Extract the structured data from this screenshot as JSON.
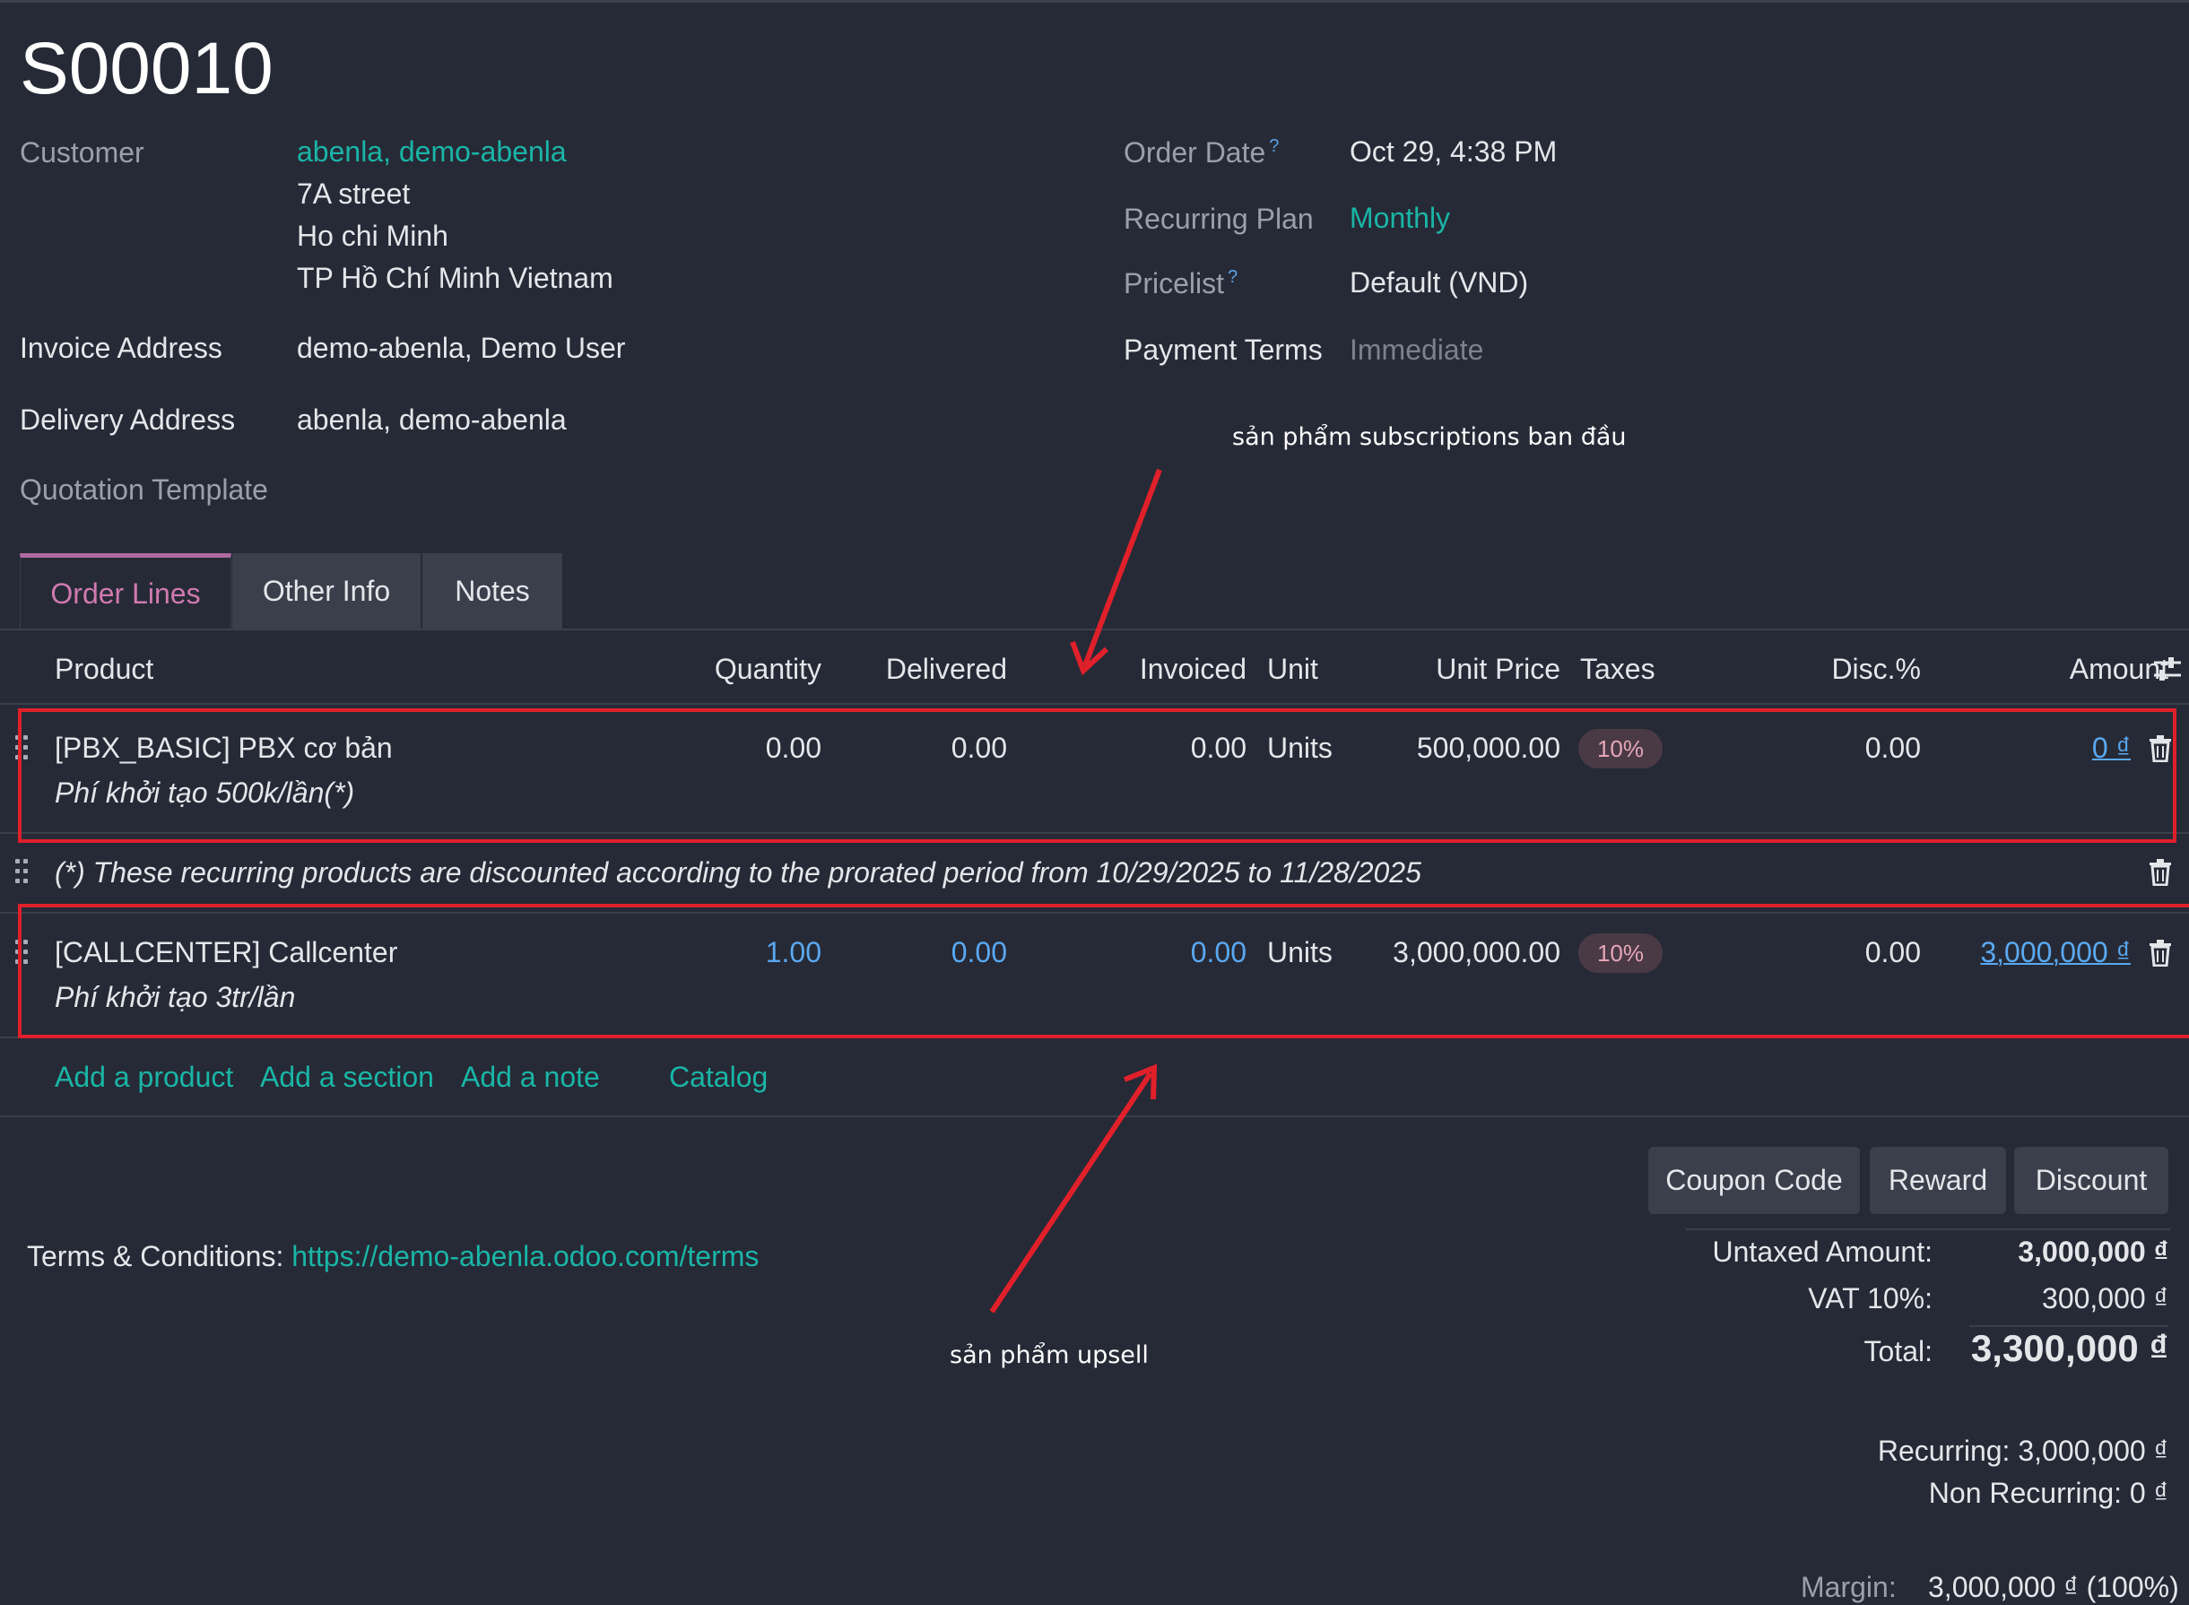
{
  "order": {
    "name": "S00010"
  },
  "left_fields": {
    "customer_label": "Customer",
    "customer_name": "abenla, demo-abenla",
    "customer_address": [
      "7A street",
      "Ho chi Minh",
      "TP Hồ Chí Minh Vietnam"
    ],
    "invoice_label": "Invoice Address",
    "invoice_value": "demo-abenla, Demo User",
    "delivery_label": "Delivery Address",
    "delivery_value": "abenla, demo-abenla",
    "template_label": "Quotation Template"
  },
  "right_fields": {
    "order_date_label": "Order Date",
    "order_date_value": "Oct 29, 4:38 PM",
    "recurring_plan_label": "Recurring Plan",
    "recurring_plan_value": "Monthly",
    "pricelist_label": "Pricelist",
    "pricelist_value": "Default (VND)",
    "payment_terms_label": "Payment Terms",
    "payment_terms_value": "Immediate",
    "help_mark": "?"
  },
  "tabs": [
    {
      "label": "Order Lines",
      "active": true
    },
    {
      "label": "Other Info",
      "active": false
    },
    {
      "label": "Notes",
      "active": false
    }
  ],
  "columns": {
    "product": "Product",
    "quantity": "Quantity",
    "delivered": "Delivered",
    "invoiced": "Invoiced",
    "unit": "Unit",
    "unit_price": "Unit Price",
    "taxes": "Taxes",
    "disc": "Disc.%",
    "amount": "Amount"
  },
  "lines": [
    {
      "product": "[PBX_BASIC] PBX cơ bản",
      "description": "Phí khởi tạo 500k/lần(*)",
      "quantity": "0.00",
      "delivered": "0.00",
      "invoiced": "0.00",
      "unit": "Units",
      "unit_price": "500,000.00",
      "tax": "10%",
      "disc": "0.00",
      "amount": "0 ₫"
    },
    {
      "note": "(*) These recurring products are discounted according to the prorated period from 10/29/2025 to 11/28/2025"
    },
    {
      "product": "[CALLCENTER] Callcenter",
      "description": "Phí khởi tạo 3tr/lần",
      "quantity": "1.00",
      "delivered": "0.00",
      "invoiced": "0.00",
      "unit": "Units",
      "unit_price": "3,000,000.00",
      "tax": "10%",
      "disc": "0.00",
      "amount": "3,000,000 ₫"
    }
  ],
  "actions": {
    "add_product": "Add a product",
    "add_section": "Add a section",
    "add_note": "Add a note",
    "catalog": "Catalog"
  },
  "buttons": {
    "coupon": "Coupon Code",
    "reward": "Reward",
    "discount": "Discount"
  },
  "terms": {
    "label": "Terms & Conditions:",
    "url": "https://demo-abenla.odoo.com/terms"
  },
  "totals": {
    "untaxed_label": "Untaxed Amount:",
    "untaxed_value": "3,000,000 ₫",
    "vat_label": "VAT 10%:",
    "vat_value": "300,000 ₫",
    "total_label": "Total:",
    "total_value": "3,300,000 ₫",
    "recurring": "Recurring: 3,000,000 ₫",
    "non_recurring": "Non Recurring: 0 ₫",
    "margin_label": "Margin:",
    "margin_value": "3,000,000 ₫ (100%)"
  },
  "annotations": {
    "top_note": "sản phẩm subscriptions ban đầu",
    "bottom_note": "sản phẩm upsell",
    "color": "#e0202a"
  }
}
